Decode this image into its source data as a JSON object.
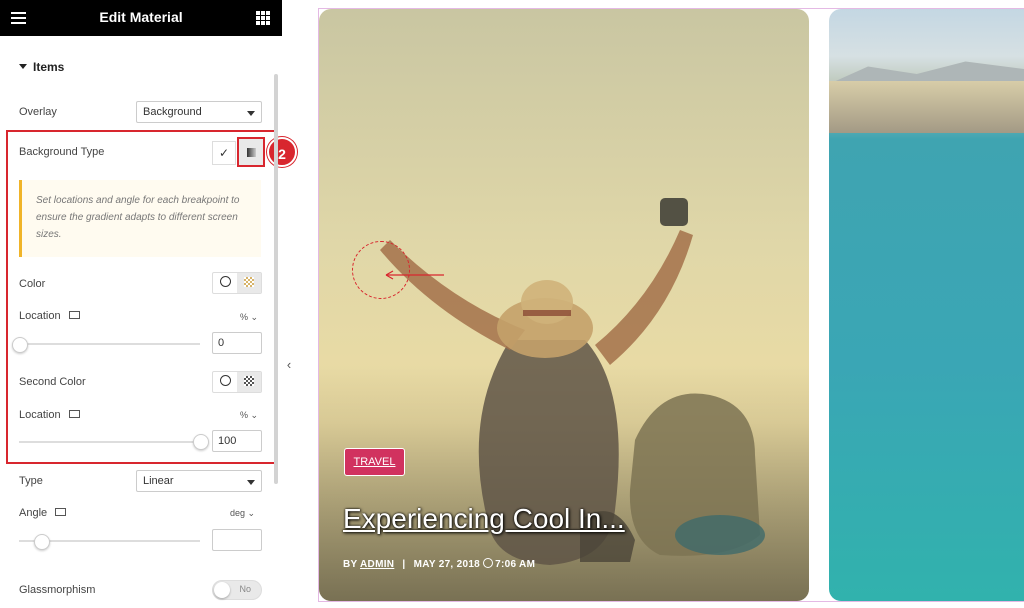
{
  "header": {
    "title": "Edit Material"
  },
  "section": {
    "label": "Items"
  },
  "overlay": {
    "label": "Overlay",
    "value": "Background"
  },
  "background_type": {
    "label": "Background Type"
  },
  "annotation": {
    "step": "2"
  },
  "notice": {
    "text": "Set locations and angle for each breakpoint to ensure the gradient adapts to different screen sizes."
  },
  "color": {
    "label": "Color",
    "location_label": "Location",
    "unit": "%",
    "location_value": "0"
  },
  "second_color": {
    "label": "Second Color",
    "location_label": "Location",
    "unit": "%",
    "location_value": "100"
  },
  "type": {
    "label": "Type",
    "value": "Linear"
  },
  "angle": {
    "label": "Angle",
    "unit": "deg",
    "value": ""
  },
  "glassmorphism": {
    "label": "Glassmorphism",
    "toggle": "No"
  },
  "sliders": {
    "color_location": 0,
    "second_color_location": 100,
    "angle_position": 0.12
  },
  "post": {
    "category": "TRAVEL",
    "title": "Experiencing Cool In...",
    "by": "BY",
    "author": "ADMIN",
    "separator": "|",
    "date": "MAY 27, 2018",
    "time": "7:06 AM"
  },
  "colors": {
    "accent": "#d8262e",
    "category_bg": "#d1325f",
    "topbar": "#000000"
  }
}
